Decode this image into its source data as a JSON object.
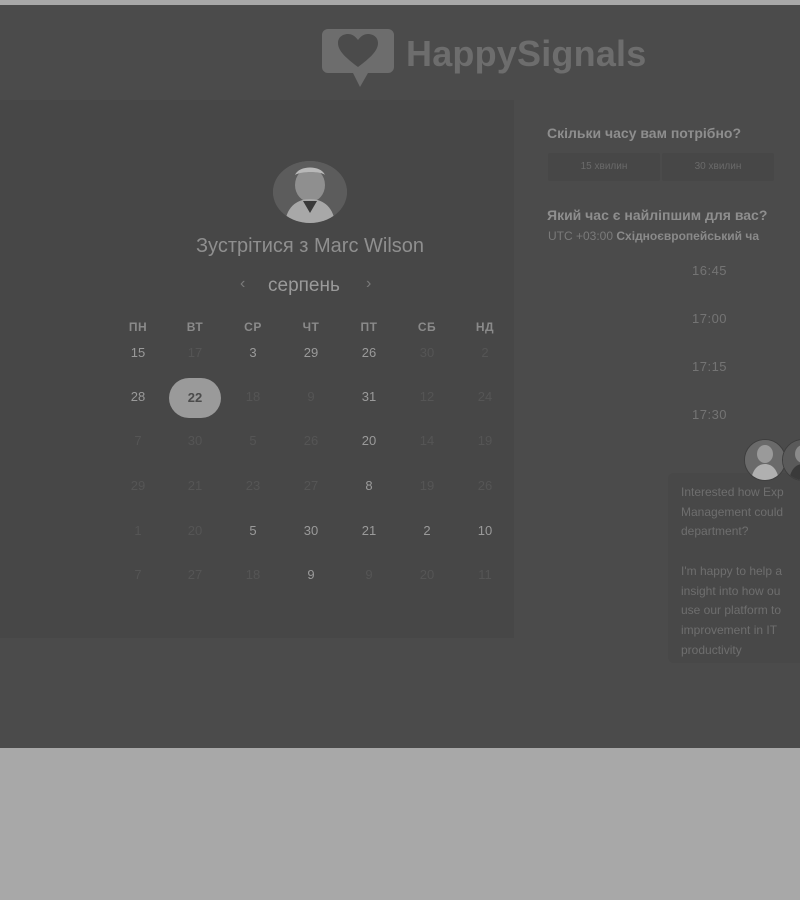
{
  "brand": {
    "name": "HappySignals"
  },
  "meeting": {
    "title": "Зустрітися з Marc Wilson",
    "month": "серпень",
    "weekdays": [
      "ПН",
      "ВТ",
      "СР",
      "ЧТ",
      "ПТ",
      "СБ",
      "НД"
    ],
    "weeks": [
      [
        "15",
        "17",
        "3",
        "29",
        "26",
        "30",
        "2"
      ],
      [
        "28",
        "22",
        "18",
        "9",
        "31",
        "12",
        "24"
      ],
      [
        "7",
        "30",
        "5",
        "26",
        "20",
        "14",
        "19"
      ],
      [
        "29",
        "21",
        "23",
        "27",
        "8",
        "19",
        "26"
      ],
      [
        "1",
        "20",
        "5",
        "30",
        "21",
        "2",
        "10"
      ],
      [
        "7",
        "27",
        "18",
        "9",
        "9",
        "20",
        "11"
      ]
    ],
    "available": [
      [
        true,
        false,
        true,
        true,
        true,
        false,
        false
      ],
      [
        true,
        true,
        false,
        false,
        true,
        false,
        false
      ],
      [
        false,
        false,
        false,
        false,
        true,
        false,
        false
      ],
      [
        false,
        false,
        false,
        false,
        true,
        false,
        false
      ],
      [
        false,
        false,
        true,
        true,
        true,
        true,
        true
      ],
      [
        false,
        false,
        false,
        true,
        false,
        false,
        false
      ]
    ],
    "selected_day": "22"
  },
  "duration": {
    "question": "Скільки часу вам потрібно?",
    "options": [
      "15 хвилин",
      "30 хвилин"
    ]
  },
  "time": {
    "question": "Який час є найліпшим для вас?",
    "timezone_offset": "UTC +03:00",
    "timezone_name": "Східноєвропейський ча",
    "slots": [
      "16:45",
      "17:00",
      "17:15",
      "17:30"
    ]
  },
  "chat": {
    "message": "Interested how Exp\nManagement could\ndepartment?\n\nI'm happy to help a\ninsight into how ou\nuse our platform to\nimprovement in IT\nproductivity"
  }
}
